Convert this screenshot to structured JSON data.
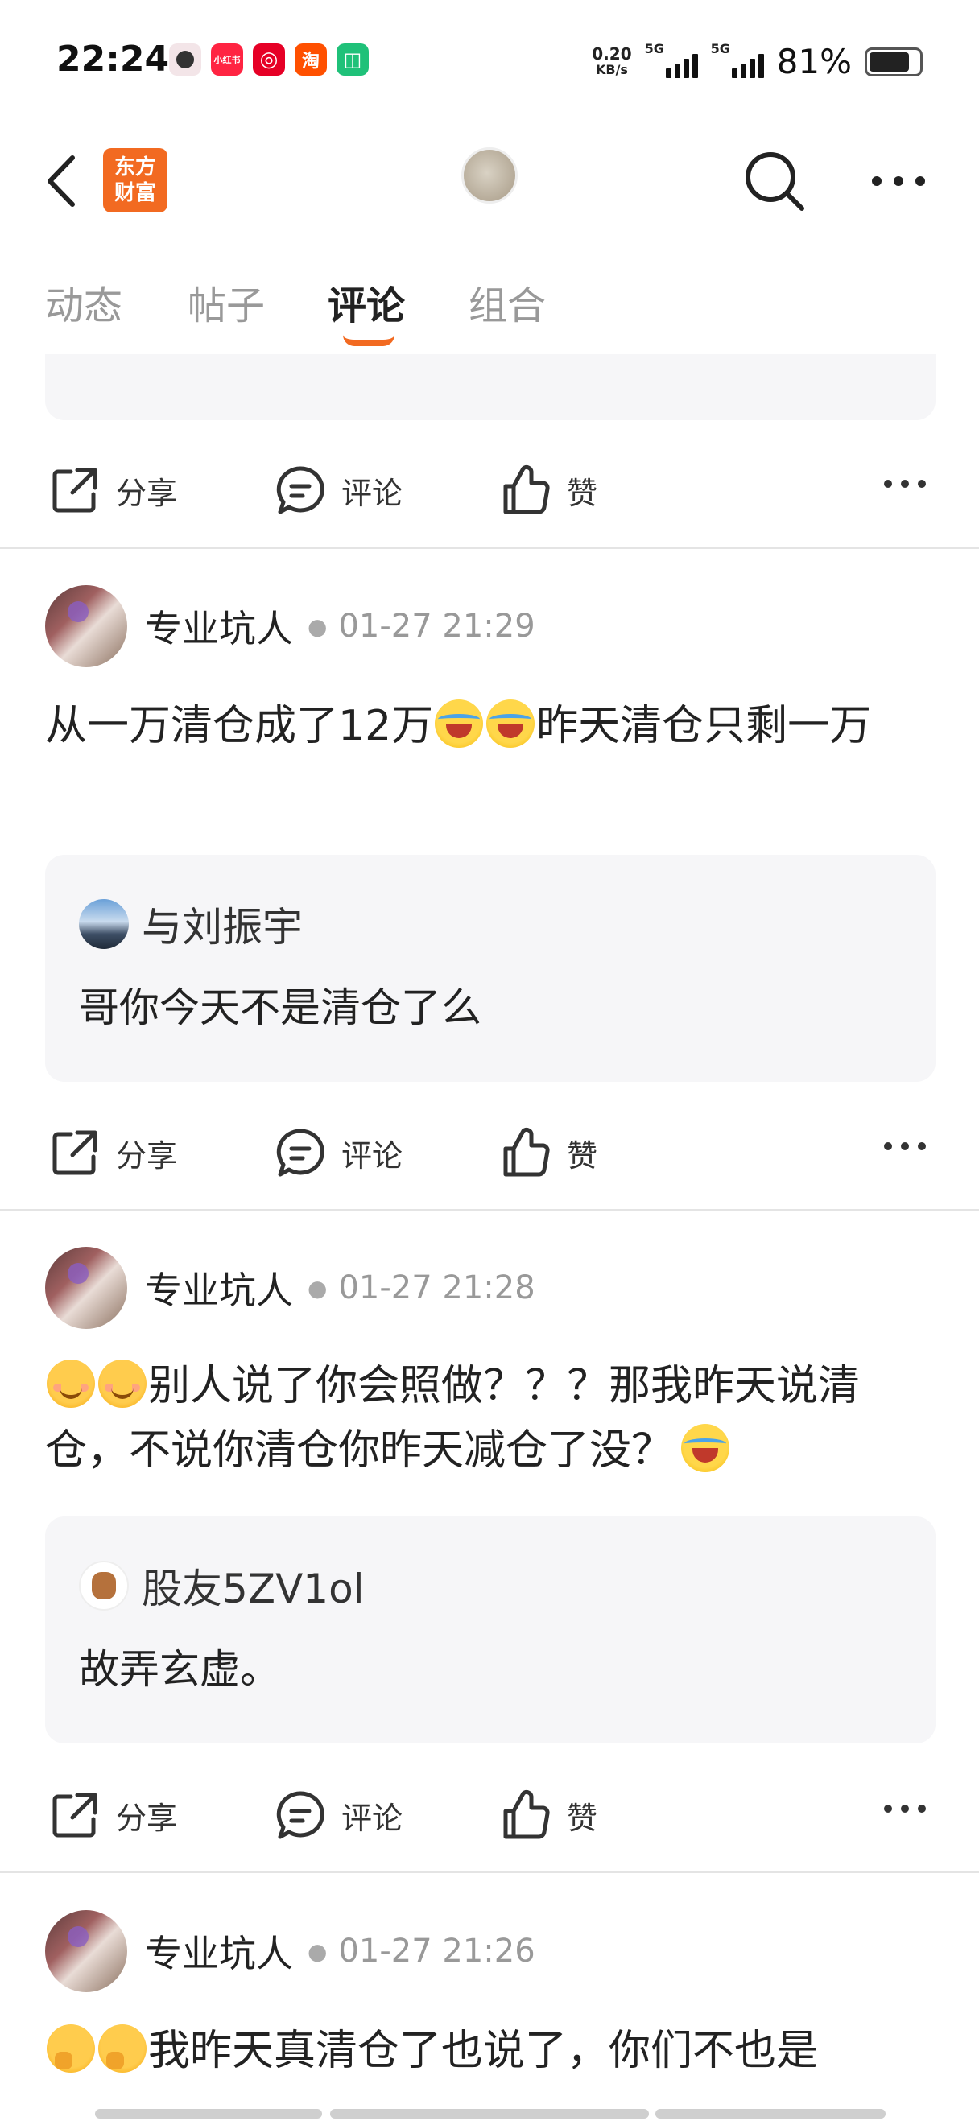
{
  "status_bar": {
    "time": "22:24",
    "net_speed_value": "0.20",
    "net_speed_unit": "KB/s",
    "signal1_label": "5G",
    "signal2_label": "5G",
    "battery": "81%",
    "app_icons": [
      {
        "name": "profile-app-icon",
        "label": "",
        "color": "#f3e5e8"
      },
      {
        "name": "xiaohongshu-app-icon",
        "label": "小红书",
        "color": "#ff2442"
      },
      {
        "name": "netease-music-app-icon",
        "label": "◎",
        "color": "#e60026"
      },
      {
        "name": "taobao-app-icon",
        "label": "淘",
        "color": "#ff5000"
      },
      {
        "name": "mi-home-app-icon",
        "label": "◫",
        "color": "#1fc179"
      }
    ]
  },
  "header": {
    "logo_line1": "东方",
    "logo_line2": "财富"
  },
  "tabs": [
    {
      "label": "动态"
    },
    {
      "label": "帖子"
    },
    {
      "label": "评论"
    },
    {
      "label": "组合"
    }
  ],
  "active_tab": "评论",
  "actions": {
    "share": "分享",
    "comment": "评论",
    "like": "赞"
  },
  "posts": [
    {
      "author": "专业坑人",
      "time": "01-27 21:29",
      "text_a": "从一万清仓成了12万",
      "text_b": "昨天清仓只剩一万",
      "reply_author": "与刘振宇",
      "reply_text": "哥你今天不是清仓了么"
    },
    {
      "author": "专业坑人",
      "time": "01-27 21:28",
      "text_a": "别人说了你会照做？？？那我昨天说清仓，不说你清仓你昨天减仓了没？",
      "reply_author": "股友5ZV1ol",
      "reply_text": "故弄玄虚。"
    },
    {
      "author": "专业坑人",
      "time": "01-27 21:26",
      "text_a": "我昨天真清仓了也说了，你们不也是"
    }
  ],
  "colors": {
    "brand": "#f26a21",
    "text": "#222222",
    "muted": "#999999",
    "reply_bg": "#f6f6f8"
  }
}
